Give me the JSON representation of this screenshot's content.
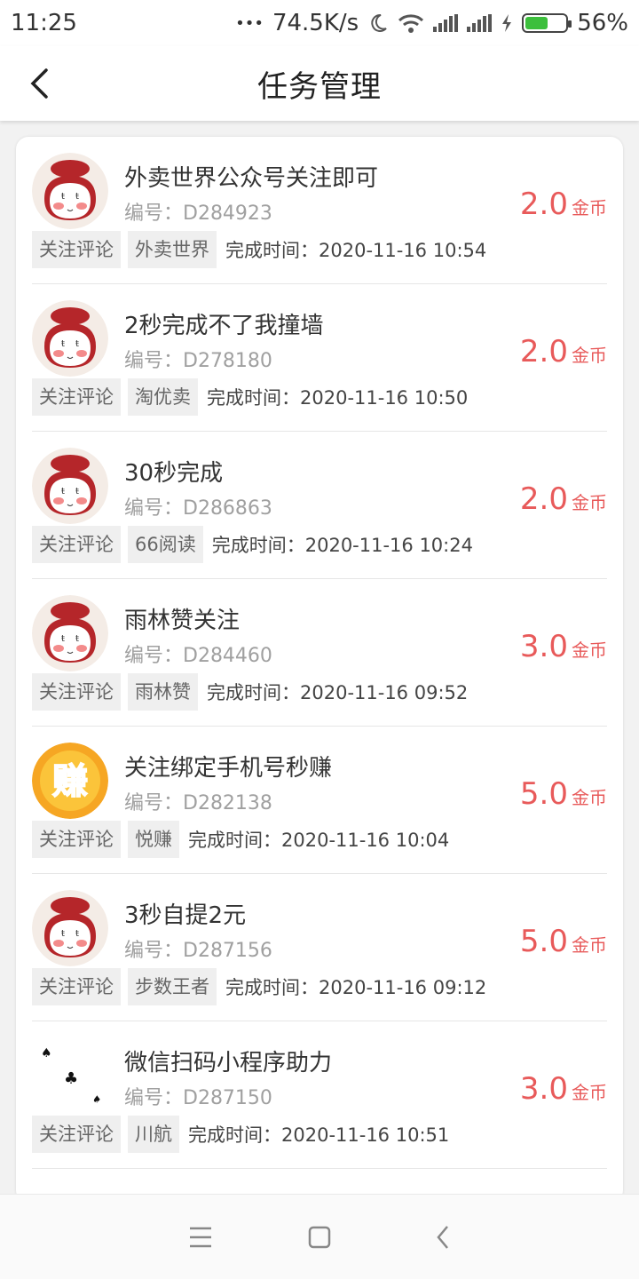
{
  "status_bar": {
    "time": "11:25",
    "dots": "•••",
    "speed": "74.5K/s",
    "battery": "56%",
    "battery_level": 0.56,
    "accent_battery": "#3cbf3c"
  },
  "header": {
    "title": "任务管理",
    "back_icon": "chevron-left-icon"
  },
  "tasks": [
    {
      "avatar": "lucky-bag-avatar",
      "name": "外卖世界公众号关注即可",
      "code": "编号：D284923",
      "price": "2.0",
      "unit": "金币",
      "tag1": "关注评论",
      "tag2": "外卖世界",
      "time": "完成时间：2020-11-16 10:54"
    },
    {
      "avatar": "lucky-bag-avatar",
      "name": "2秒完成不了我撞墙",
      "code": "编号：D278180",
      "price": "2.0",
      "unit": "金币",
      "tag1": "关注评论",
      "tag2": "淘优卖",
      "time": "完成时间：2020-11-16 10:50"
    },
    {
      "avatar": "lucky-bag-avatar",
      "name": "30秒完成",
      "code": "编号：D286863",
      "price": "2.0",
      "unit": "金币",
      "tag1": "关注评论",
      "tag2": "66阅读",
      "time": "完成时间：2020-11-16 10:24"
    },
    {
      "avatar": "lucky-bag-avatar",
      "name": "雨林赞关注",
      "code": "编号：D284460",
      "price": "3.0",
      "unit": "金币",
      "tag1": "关注评论",
      "tag2": "雨林赞",
      "time": "完成时间：2020-11-16 09:52"
    },
    {
      "avatar": "earn-avatar",
      "avatar_text": "赚",
      "name": "关注绑定手机号秒赚",
      "code": "编号：D282138",
      "price": "5.0",
      "unit": "金币",
      "tag1": "关注评论",
      "tag2": "悦赚",
      "time": "完成时间：2020-11-16 10:04"
    },
    {
      "avatar": "lucky-bag-avatar",
      "name": "3秒自提2元",
      "code": "编号：D287156",
      "price": "5.0",
      "unit": "金币",
      "tag1": "关注评论",
      "tag2": "步数王者",
      "time": "完成时间：2020-11-16 09:12"
    },
    {
      "avatar": "cards-avatar",
      "name": "微信扫码小程序助力",
      "code": "编号：D287150",
      "price": "3.0",
      "unit": "金币",
      "tag1": "关注评论",
      "tag2": "川航",
      "time": "完成时间：2020-11-16 10:51"
    }
  ],
  "colors": {
    "price": "#e85a5a",
    "tag_bg": "#efefef",
    "page_bg": "#f2f2f2"
  },
  "bottom_nav": {
    "menu_icon": "menu-icon",
    "home_icon": "home-square-icon",
    "back_icon": "back-triangle-icon"
  }
}
